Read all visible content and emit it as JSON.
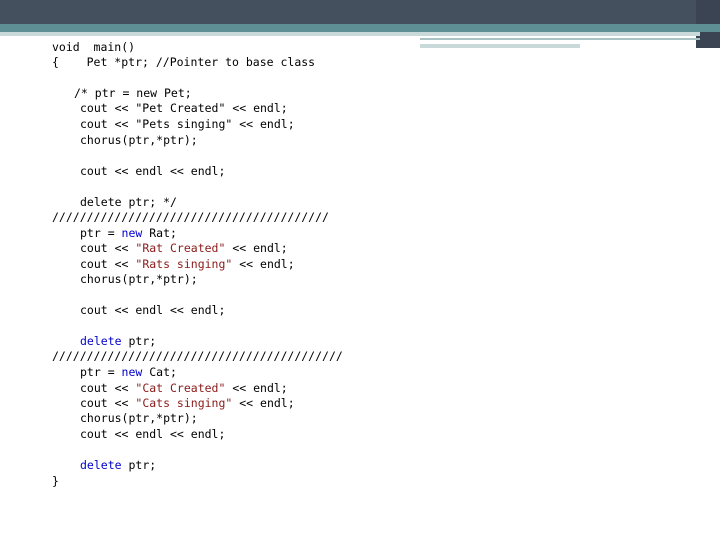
{
  "code": {
    "l1": "void  main()",
    "l2": "{    Pet *ptr; //Pointer to base class",
    "l3": "/* ptr = new Pet;",
    "l4": "cout << \"Pet Created\" << endl;",
    "l5": "cout << \"Pets singing\" << endl;",
    "l6": "chorus(ptr,*ptr);",
    "l7": "cout << endl << endl;",
    "l8": "delete ptr; */",
    "l9": "////////////////////////////////////////",
    "l10_pre": "ptr = ",
    "l10_kw": "new",
    "l10_post": " Rat;",
    "l11_pre": "cout << ",
    "l11_str": "\"Rat Created\"",
    "l11_post": " << endl;",
    "l12_pre": "cout << ",
    "l12_str": "\"Rats singing\"",
    "l12_post": " << endl;",
    "l13": "chorus(ptr,*ptr);",
    "l14": "cout << endl << endl;",
    "l15_kw": "delete",
    "l15_post": " ptr;",
    "l16": "//////////////////////////////////////////",
    "l17_pre": "ptr = ",
    "l17_kw": "new",
    "l17_post": " Cat;",
    "l18_pre": "cout << ",
    "l18_str": "\"Cat Created\"",
    "l18_post": " << endl;",
    "l19_pre": "cout << ",
    "l19_str": "\"Cats singing\"",
    "l19_post": " << endl;",
    "l20": "chorus(ptr,*ptr);",
    "l21": "cout << endl << endl;",
    "l22_kw": "delete",
    "l22_post": " ptr;",
    "l23": "}"
  },
  "colors": {
    "keyword": "#0000cc",
    "string": "#8b1a1a",
    "header": "#45505e",
    "accent": "#5e8f94"
  }
}
